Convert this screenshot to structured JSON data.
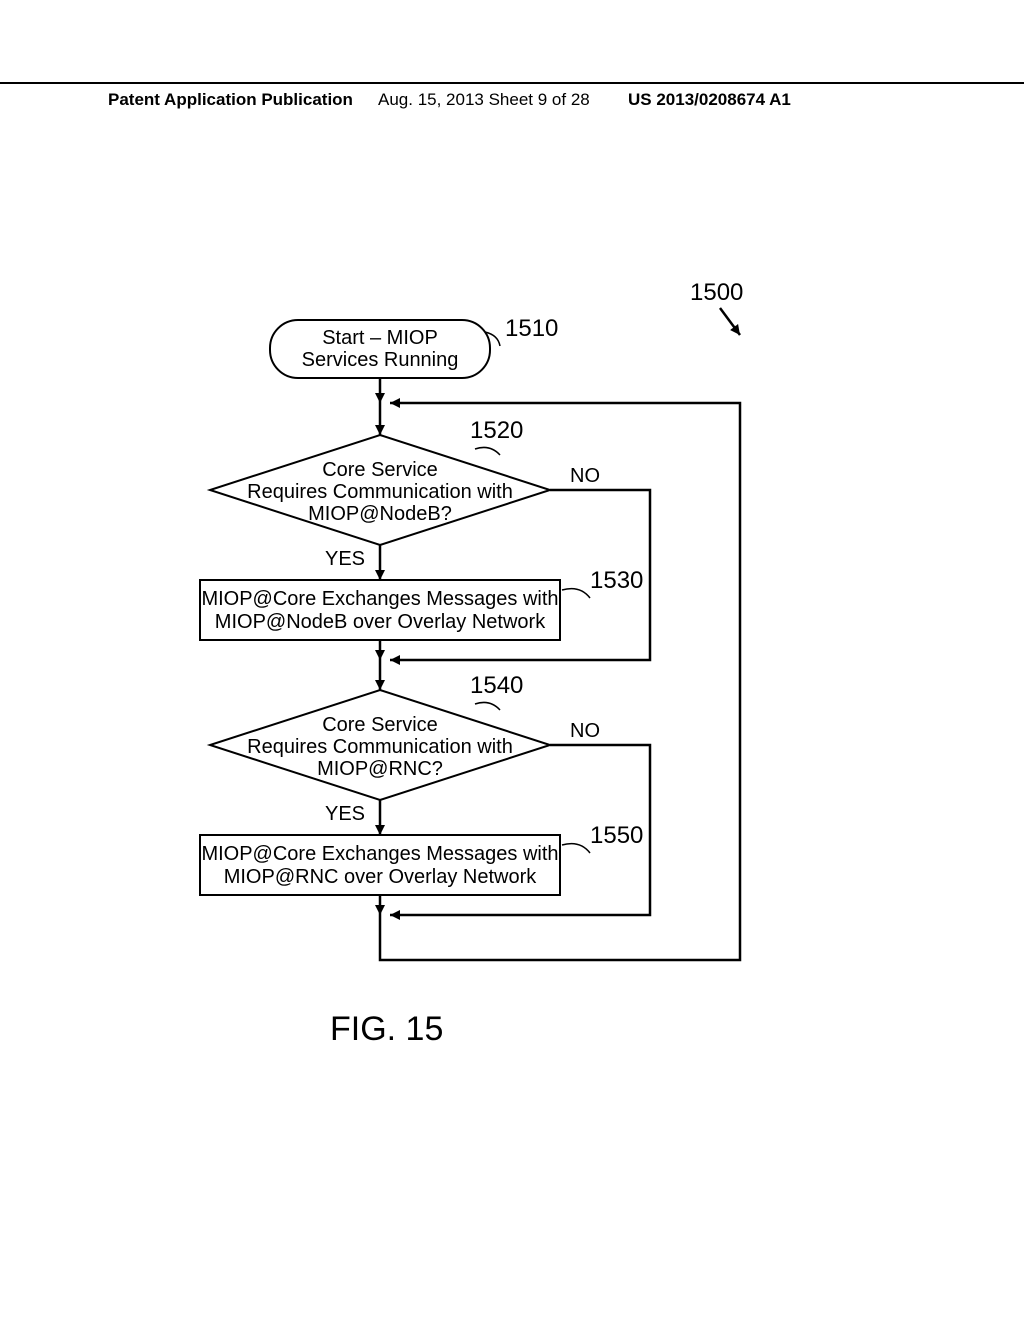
{
  "header": {
    "left": "Patent Application Publication",
    "mid": "Aug. 15, 2013  Sheet 9 of 28",
    "right": "US 2013/0208674 A1"
  },
  "refs": {
    "r1500": "1500",
    "r1510": "1510",
    "r1520": "1520",
    "r1530": "1530",
    "r1540": "1540",
    "r1550": "1550"
  },
  "nodes": {
    "start_l1": "Start – MIOP",
    "start_l2": "Services Running",
    "d1_l1": "Core Service",
    "d1_l2": "Requires Communication with",
    "d1_l3": "MIOP@NodeB?",
    "p1_l1": "MIOP@Core Exchanges Messages with",
    "p1_l2": "MIOP@NodeB over Overlay Network",
    "d2_l1": "Core Service",
    "d2_l2": "Requires Communication with",
    "d2_l3": "MIOP@RNC?",
    "p2_l1": "MIOP@Core Exchanges Messages with",
    "p2_l2": "MIOP@RNC over Overlay Network"
  },
  "branches": {
    "yes": "YES",
    "no": "NO"
  },
  "figure": "FIG. 15"
}
